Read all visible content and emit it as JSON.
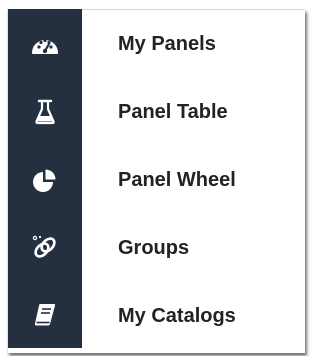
{
  "menu": {
    "items": [
      {
        "icon": "dashboard-gauge-icon",
        "label": "My Panels"
      },
      {
        "icon": "flask-icon",
        "label": "Panel Table"
      },
      {
        "icon": "pie-chart-icon",
        "label": "Panel Wheel"
      },
      {
        "icon": "chain-link-icon",
        "label": "Groups"
      },
      {
        "icon": "book-icon",
        "label": "My Catalogs"
      }
    ]
  },
  "colors": {
    "sidebar_bg": "#242f3f",
    "icon": "#ffffff",
    "label_text": "#222222"
  }
}
